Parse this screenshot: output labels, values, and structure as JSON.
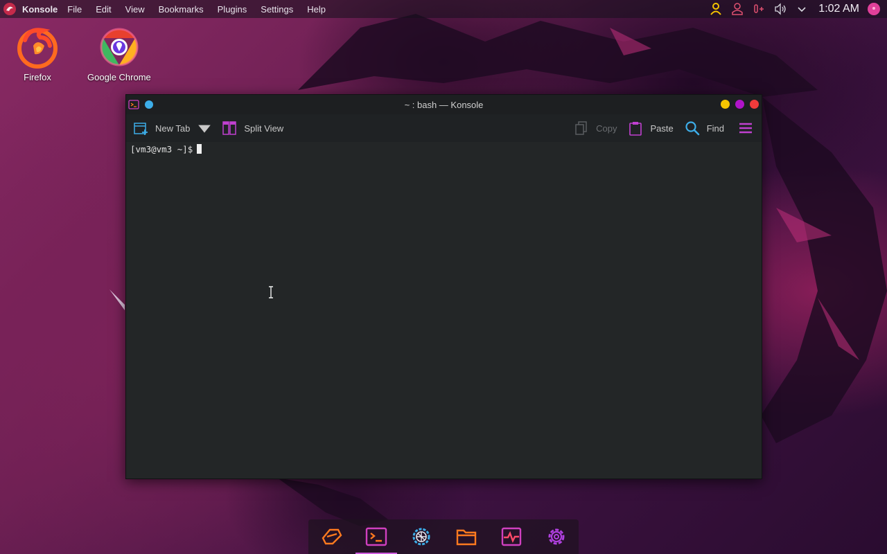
{
  "panel": {
    "app_name": "Konsole",
    "menu": [
      "File",
      "Edit",
      "View",
      "Bookmarks",
      "Plugins",
      "Settings",
      "Help"
    ],
    "clock": "1:02 AM",
    "tray_icons": [
      "user-icon",
      "user-outline-icon",
      "microphone-icon",
      "volume-icon",
      "chevron-down-icon"
    ]
  },
  "desktop": {
    "icons": [
      {
        "label": "Firefox",
        "icon": "firefox-icon"
      },
      {
        "label": "Google Chrome",
        "icon": "chrome-icon"
      }
    ]
  },
  "window": {
    "title": "~ : bash — Konsole",
    "toolbar": {
      "new_tab": "New Tab",
      "split_view": "Split View",
      "copy": "Copy",
      "paste": "Paste",
      "find": "Find"
    },
    "terminal": {
      "prompt": "[vm3@vm3 ~]$"
    }
  },
  "dock": {
    "items": [
      "launcher-icon",
      "terminal-icon",
      "network-settings-icon",
      "files-icon",
      "system-monitor-icon",
      "settings-icon"
    ],
    "active": "terminal-icon"
  },
  "colors": {
    "accent_orange": "#ff7a1f",
    "accent_magenta": "#c040d0",
    "accent_blue": "#3daee9",
    "close": "#ef3b3b",
    "minimize": "#f5c400",
    "maximize": "#b014c8",
    "terminal_bg": "#232627"
  }
}
